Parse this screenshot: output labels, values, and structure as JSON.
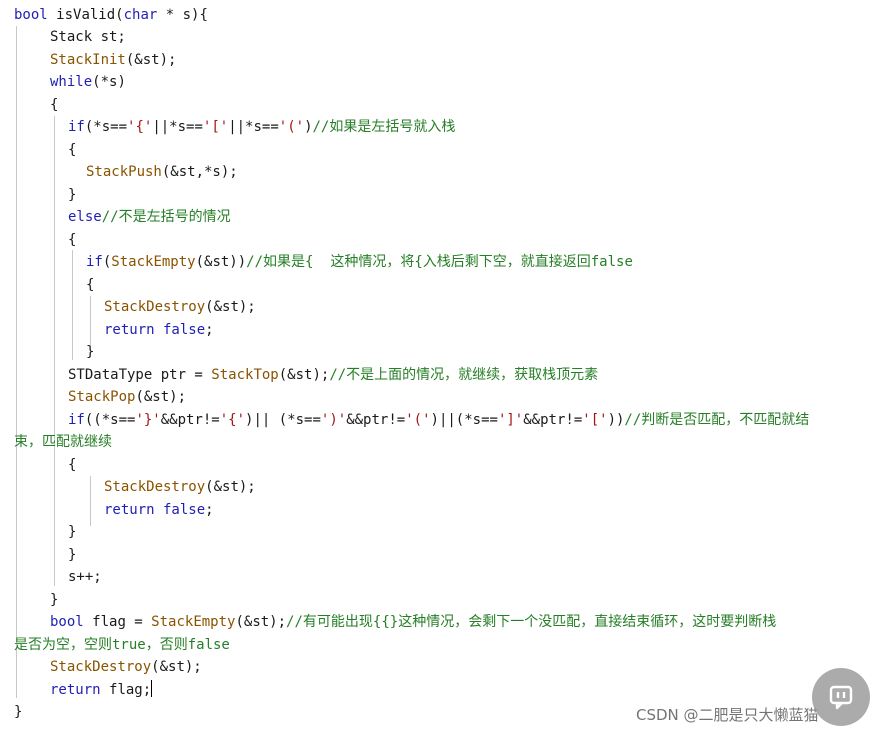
{
  "code_lines": [
    {
      "parts": [
        {
          "t": "bool ",
          "c": "kw"
        },
        {
          "t": "isValid(",
          "c": "plain"
        },
        {
          "t": "char",
          "c": "kw"
        },
        {
          "t": " * s){",
          "c": "plain"
        }
      ]
    },
    {
      "parts": [
        {
          "t": "Stack st;",
          "c": "plain"
        }
      ]
    },
    {
      "parts": [
        {
          "t": "StackInit",
          "c": "fn"
        },
        {
          "t": "(&st);",
          "c": "plain"
        }
      ]
    },
    {
      "parts": [
        {
          "t": "while",
          "c": "kw"
        },
        {
          "t": "(*s)",
          "c": "plain"
        }
      ]
    },
    {
      "parts": [
        {
          "t": "{",
          "c": "plain"
        }
      ]
    },
    {
      "parts": [
        {
          "t": "if",
          "c": "kw"
        },
        {
          "t": "(*s==",
          "c": "plain"
        },
        {
          "t": "'{'",
          "c": "str"
        },
        {
          "t": "||*s==",
          "c": "plain"
        },
        {
          "t": "'['",
          "c": "str"
        },
        {
          "t": "||*s==",
          "c": "plain"
        },
        {
          "t": "'('",
          "c": "str"
        },
        {
          "t": ")",
          "c": "plain"
        },
        {
          "t": "//如果是左括号就入栈",
          "c": "cmt"
        }
      ]
    },
    {
      "parts": [
        {
          "t": "{",
          "c": "plain"
        }
      ]
    },
    {
      "parts": [
        {
          "t": "StackPush",
          "c": "fn"
        },
        {
          "t": "(&st,*s);",
          "c": "plain"
        }
      ]
    },
    {
      "parts": [
        {
          "t": "}",
          "c": "plain"
        }
      ]
    },
    {
      "parts": [
        {
          "t": "else",
          "c": "kw"
        },
        {
          "t": "//不是左括号的情况",
          "c": "cmt"
        }
      ]
    },
    {
      "parts": [
        {
          "t": "{",
          "c": "plain"
        }
      ]
    },
    {
      "parts": [
        {
          "t": "if",
          "c": "kw"
        },
        {
          "t": "(",
          "c": "plain"
        },
        {
          "t": "StackEmpty",
          "c": "fn"
        },
        {
          "t": "(&st))",
          "c": "plain"
        },
        {
          "t": "//如果是{  这种情况，将{入栈后剩下空，就直接返回false",
          "c": "cmt"
        }
      ]
    },
    {
      "parts": [
        {
          "t": "{",
          "c": "plain"
        }
      ]
    },
    {
      "parts": [
        {
          "t": "StackDestroy",
          "c": "fn"
        },
        {
          "t": "(&st);",
          "c": "plain"
        }
      ]
    },
    {
      "parts": [
        {
          "t": "return false",
          "c": "kw"
        },
        {
          "t": ";",
          "c": "plain"
        }
      ]
    },
    {
      "parts": [
        {
          "t": "}",
          "c": "plain"
        }
      ]
    },
    {
      "parts": [
        {
          "t": "STDataType ptr = ",
          "c": "plain"
        },
        {
          "t": "StackTop",
          "c": "fn"
        },
        {
          "t": "(&st);",
          "c": "plain"
        },
        {
          "t": "//不是上面的情况，就继续，获取栈顶元素",
          "c": "cmt"
        }
      ]
    },
    {
      "parts": [
        {
          "t": "StackPop",
          "c": "fn"
        },
        {
          "t": "(&st);",
          "c": "plain"
        }
      ]
    },
    {
      "parts": [
        {
          "t": "if",
          "c": "kw"
        },
        {
          "t": "((*s==",
          "c": "plain"
        },
        {
          "t": "'}'",
          "c": "str"
        },
        {
          "t": "&&ptr!=",
          "c": "plain"
        },
        {
          "t": "'{'",
          "c": "str"
        },
        {
          "t": ")|| (*s==",
          "c": "plain"
        },
        {
          "t": "')'",
          "c": "str"
        },
        {
          "t": "&&ptr!=",
          "c": "plain"
        },
        {
          "t": "'('",
          "c": "str"
        },
        {
          "t": ")||(*s==",
          "c": "plain"
        },
        {
          "t": "']'",
          "c": "str"
        },
        {
          "t": "&&ptr!=",
          "c": "plain"
        },
        {
          "t": "'['",
          "c": "str"
        },
        {
          "t": "))",
          "c": "plain"
        },
        {
          "t": "//判断是否匹配，不匹配就结",
          "c": "cmt"
        }
      ]
    },
    {
      "parts": [
        {
          "t": "束，匹配就继续",
          "c": "cmt"
        }
      ]
    },
    {
      "parts": [
        {
          "t": "{",
          "c": "plain"
        }
      ]
    },
    {
      "parts": [
        {
          "t": "StackDestroy",
          "c": "fn"
        },
        {
          "t": "(&st);",
          "c": "plain"
        }
      ]
    },
    {
      "parts": [
        {
          "t": "return false",
          "c": "kw"
        },
        {
          "t": ";",
          "c": "plain"
        }
      ]
    },
    {
      "parts": [
        {
          "t": "}",
          "c": "plain"
        }
      ]
    },
    {
      "parts": [
        {
          "t": "}",
          "c": "plain"
        }
      ]
    },
    {
      "parts": [
        {
          "t": "s++;",
          "c": "plain"
        }
      ]
    },
    {
      "parts": [
        {
          "t": "}",
          "c": "plain"
        }
      ]
    },
    {
      "parts": [
        {
          "t": "bool ",
          "c": "kw"
        },
        {
          "t": "flag = ",
          "c": "plain"
        },
        {
          "t": "StackEmpty",
          "c": "fn"
        },
        {
          "t": "(&st);",
          "c": "plain"
        },
        {
          "t": "//有可能出现{{}这种情况，会剩下一个没匹配，直接结束循环，这时要判断栈",
          "c": "cmt"
        }
      ]
    },
    {
      "parts": [
        {
          "t": "是否为空，空则true，否则false",
          "c": "cmt"
        }
      ]
    },
    {
      "parts": [
        {
          "t": "StackDestroy",
          "c": "fn"
        },
        {
          "t": "(&st);",
          "c": "plain"
        }
      ]
    },
    {
      "parts": [
        {
          "t": "return ",
          "c": "kw"
        },
        {
          "t": "flag;",
          "c": "plain"
        }
      ]
    },
    {
      "parts": [
        {
          "t": "}",
          "c": "plain"
        }
      ]
    }
  ],
  "watermark": "CSDN @二肥是只大懒蓝猫",
  "badge_icon": "chat-bubble-icon"
}
